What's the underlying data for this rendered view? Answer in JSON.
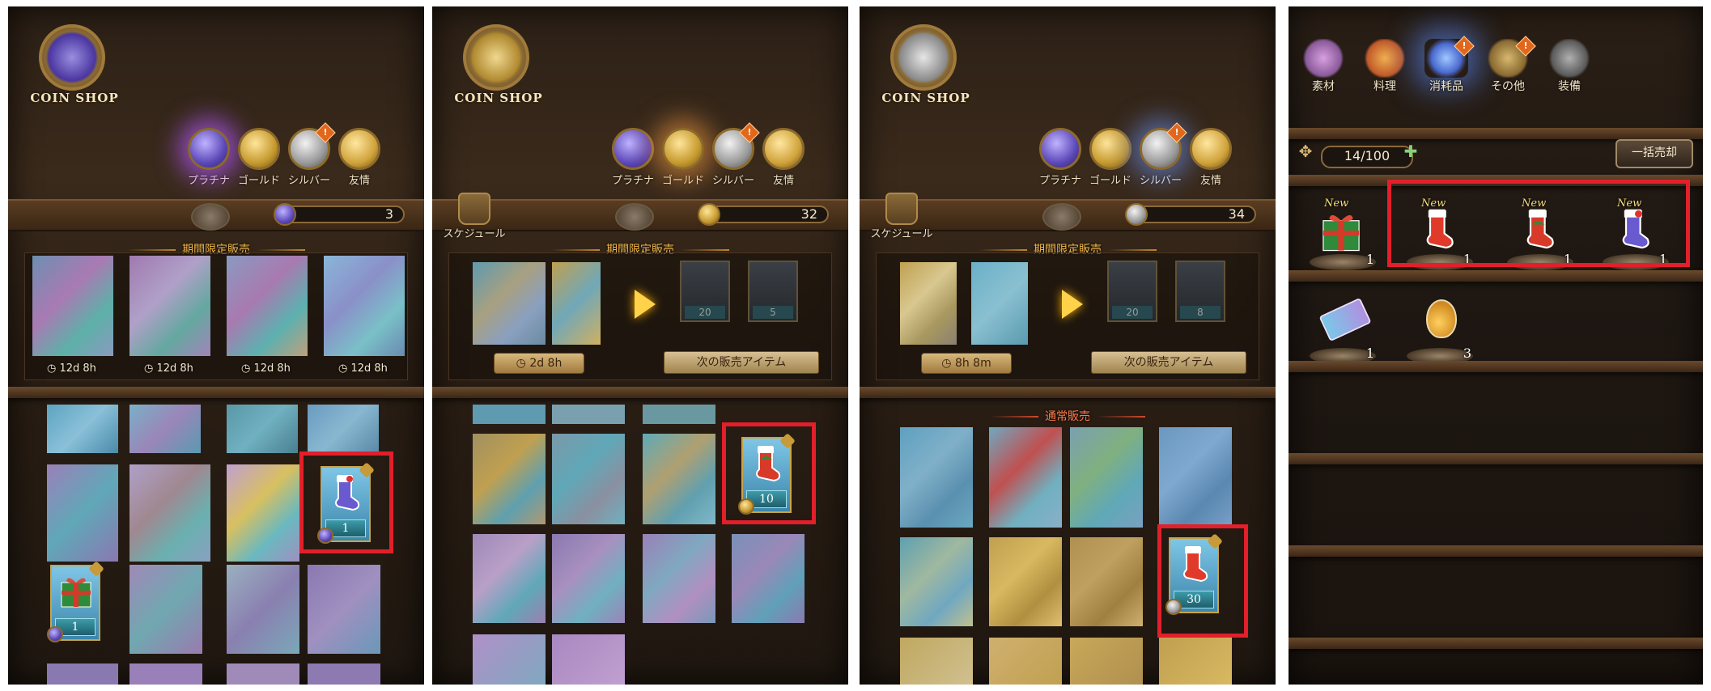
{
  "panels": [
    {
      "logo_text": "COIN SHOP",
      "tabs": [
        {
          "label": "プラチナ",
          "icon": "platinum-coin-icon",
          "active": true
        },
        {
          "label": "ゴールド",
          "icon": "gold-coin-icon"
        },
        {
          "label": "シルバー",
          "icon": "silver-coin-icon",
          "badge": "!"
        },
        {
          "label": "友情",
          "icon": "friendship-coin-icon"
        }
      ],
      "balance": "3",
      "limited_title": "期間限定販売",
      "timers": [
        "12d 8h",
        "12d 8h",
        "12d 8h",
        "12d 8h"
      ],
      "highlight_item": {
        "count": "1",
        "icon": "blue-stocking-icon"
      },
      "gift_item": {
        "count": "1",
        "icon": "gift-box-icon"
      }
    },
    {
      "logo_text": "COIN SHOP",
      "tabs": [
        {
          "label": "プラチナ",
          "icon": "platinum-coin-icon"
        },
        {
          "label": "ゴールド",
          "icon": "gold-coin-icon",
          "active": true
        },
        {
          "label": "シルバー",
          "icon": "silver-coin-icon",
          "badge": "!"
        },
        {
          "label": "友情",
          "icon": "friendship-coin-icon"
        }
      ],
      "schedule_label": "スケジュール",
      "balance": "32",
      "limited_title": "期間限定販売",
      "timer": "2d 8h",
      "next_label": "次の販売アイテム",
      "next_prices": [
        "20",
        "5"
      ],
      "highlight_item": {
        "count": "10",
        "icon": "green-stocking-icon"
      }
    },
    {
      "logo_text": "COIN SHOP",
      "tabs": [
        {
          "label": "プラチナ",
          "icon": "platinum-coin-icon"
        },
        {
          "label": "ゴールド",
          "icon": "gold-coin-icon"
        },
        {
          "label": "シルバー",
          "icon": "silver-coin-icon",
          "badge": "!",
          "active": true
        },
        {
          "label": "友情",
          "icon": "friendship-coin-icon"
        }
      ],
      "schedule_label": "スケジュール",
      "balance": "34",
      "limited_title": "期間限定販売",
      "timer": "8h 8m",
      "next_label": "次の販売アイテム",
      "next_prices": [
        "20",
        "8"
      ],
      "normal_title": "通常販売",
      "highlight_item": {
        "count": "30",
        "icon": "red-stocking-icon"
      }
    },
    {
      "inv_tabs": [
        {
          "label": "素材",
          "icon": "materials-icon"
        },
        {
          "label": "料理",
          "icon": "food-icon"
        },
        {
          "label": "消耗品",
          "icon": "consumables-icon",
          "badge": "!",
          "active": true
        },
        {
          "label": "その他",
          "icon": "other-icon",
          "badge": "!"
        },
        {
          "label": "装備",
          "icon": "equipment-icon"
        }
      ],
      "capacity": "14/100",
      "sell_all": "一括売却",
      "items_row1": [
        {
          "icon": "gift-box-icon",
          "new": "New",
          "qty": "1"
        },
        {
          "icon": "red-stocking-icon",
          "new": "New",
          "qty": "1"
        },
        {
          "icon": "green-stocking-icon",
          "new": "New",
          "qty": "1"
        },
        {
          "icon": "blue-stocking-icon",
          "new": "New",
          "qty": "1"
        }
      ],
      "items_row2": [
        {
          "icon": "ticket-icon",
          "qty": "1"
        },
        {
          "icon": "potion-icon",
          "qty": "3"
        }
      ]
    }
  ],
  "colors": {
    "highlight": "#e21f2a",
    "platinum": "#7a62d8",
    "gold": "#c69a2f",
    "silver": "#9a9a9a",
    "count_bar": "#2b7a8a"
  }
}
